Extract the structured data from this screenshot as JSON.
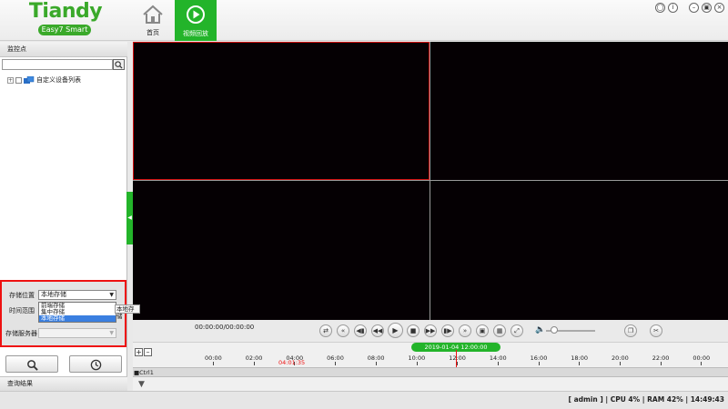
{
  "app": {
    "logo": "Tiandy",
    "logo_sub": "Easy7 Smart"
  },
  "nav": {
    "home_label": "首页",
    "playback_label": "视频回放"
  },
  "sidebar": {
    "title": "监控点",
    "search_placeholder": "",
    "tree_root": "自定义设备列表"
  },
  "query": {
    "storage_location_label": "存储位置",
    "storage_location_value": "本地存储",
    "storage_options": [
      "前端存储",
      "集中存储",
      "本地存储"
    ],
    "selected_option_index": 2,
    "time_range_label": "时间范围",
    "tooltip": "本地存储",
    "storage_server_label": "存储服务器",
    "storage_server_value": "",
    "results_label": "查询结果"
  },
  "playback": {
    "timecode": "00:00:00/00:00:00",
    "volume": 0.1
  },
  "timeline": {
    "date": "2019-01-04 12:00:00",
    "current_time": "04:01:35",
    "ticks": [
      "00:00",
      "02:00",
      "04:00",
      "06:00",
      "08:00",
      "10:00",
      "12:00",
      "14:00",
      "16:00",
      "18:00",
      "20:00",
      "22:00",
      "00:00"
    ],
    "track_name": "■Ctrl1"
  },
  "status": {
    "text": "[ admin ] | CPU   4% | RAM  42% | 14:49:43"
  },
  "colors": {
    "brand_green": "#23b42a",
    "alert_red": "#e11111",
    "video_bg": "#050003"
  }
}
